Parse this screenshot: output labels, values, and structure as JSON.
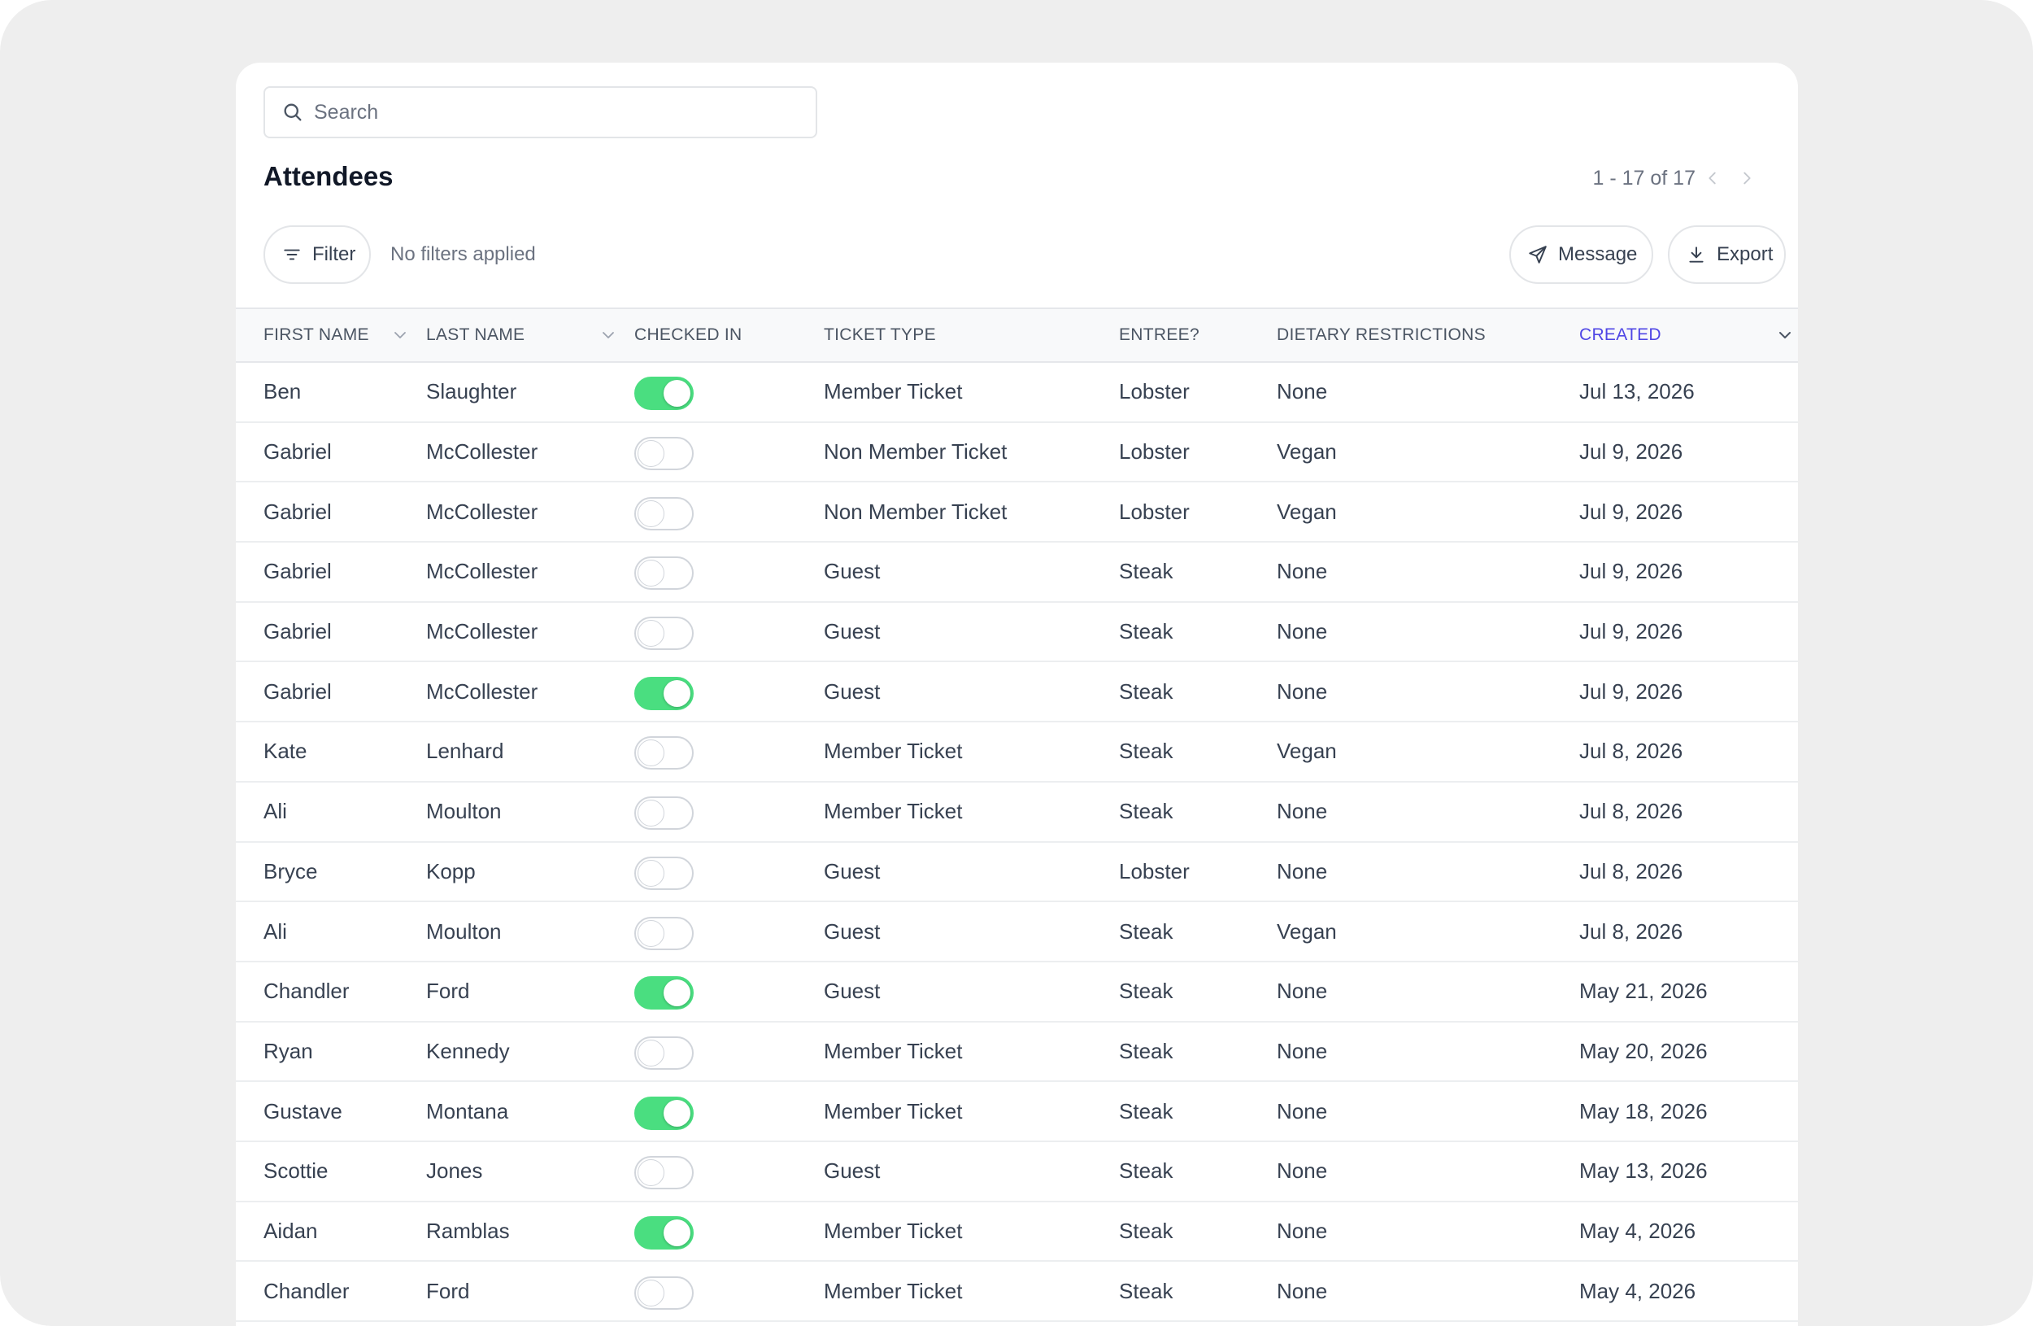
{
  "search": {
    "placeholder": "Search",
    "value": ""
  },
  "page_title": "Attendees",
  "pagination": {
    "range_text": "1 - 17 of 17"
  },
  "toolbar": {
    "filter_label": "Filter",
    "filter_status": "No filters applied",
    "message_label": "Message",
    "export_label": "Export"
  },
  "colors": {
    "toggle_on": "#4ade80",
    "active_sort_header": "#4f46e5"
  },
  "table": {
    "columns": [
      {
        "key": "first_name",
        "label": "FIRST NAME",
        "sortable": true,
        "active": false
      },
      {
        "key": "last_name",
        "label": "LAST NAME",
        "sortable": true,
        "active": false
      },
      {
        "key": "checked_in",
        "label": "CHECKED IN",
        "sortable": false,
        "active": false
      },
      {
        "key": "ticket_type",
        "label": "TICKET TYPE",
        "sortable": false,
        "active": false
      },
      {
        "key": "entree",
        "label": "ENTREE?",
        "sortable": false,
        "active": false
      },
      {
        "key": "dietary",
        "label": "DIETARY RESTRICTIONS",
        "sortable": false,
        "active": false
      },
      {
        "key": "created",
        "label": "CREATED",
        "sortable": true,
        "active": true
      }
    ],
    "rows": [
      {
        "first_name": "Ben",
        "last_name": "Slaughter",
        "checked_in": true,
        "ticket_type": "Member Ticket",
        "entree": "Lobster",
        "dietary": "None",
        "created": "Jul 13, 2026"
      },
      {
        "first_name": "Gabriel",
        "last_name": "McCollester",
        "checked_in": false,
        "ticket_type": "Non Member Ticket",
        "entree": "Lobster",
        "dietary": "Vegan",
        "created": "Jul 9, 2026"
      },
      {
        "first_name": "Gabriel",
        "last_name": "McCollester",
        "checked_in": false,
        "ticket_type": "Non Member Ticket",
        "entree": "Lobster",
        "dietary": "Vegan",
        "created": "Jul 9, 2026"
      },
      {
        "first_name": "Gabriel",
        "last_name": "McCollester",
        "checked_in": false,
        "ticket_type": "Guest",
        "entree": "Steak",
        "dietary": "None",
        "created": "Jul 9, 2026"
      },
      {
        "first_name": "Gabriel",
        "last_name": "McCollester",
        "checked_in": false,
        "ticket_type": "Guest",
        "entree": "Steak",
        "dietary": "None",
        "created": "Jul 9, 2026"
      },
      {
        "first_name": "Gabriel",
        "last_name": "McCollester",
        "checked_in": true,
        "ticket_type": "Guest",
        "entree": "Steak",
        "dietary": "None",
        "created": "Jul 9, 2026"
      },
      {
        "first_name": "Kate",
        "last_name": "Lenhard",
        "checked_in": false,
        "ticket_type": "Member Ticket",
        "entree": "Steak",
        "dietary": "Vegan",
        "created": "Jul 8, 2026"
      },
      {
        "first_name": "Ali",
        "last_name": "Moulton",
        "checked_in": false,
        "ticket_type": "Member Ticket",
        "entree": "Steak",
        "dietary": "None",
        "created": "Jul 8, 2026"
      },
      {
        "first_name": "Bryce",
        "last_name": "Kopp",
        "checked_in": false,
        "ticket_type": "Guest",
        "entree": "Lobster",
        "dietary": "None",
        "created": "Jul 8, 2026"
      },
      {
        "first_name": "Ali",
        "last_name": "Moulton",
        "checked_in": false,
        "ticket_type": "Guest",
        "entree": "Steak",
        "dietary": "Vegan",
        "created": "Jul 8, 2026"
      },
      {
        "first_name": "Chandler",
        "last_name": "Ford",
        "checked_in": true,
        "ticket_type": "Guest",
        "entree": "Steak",
        "dietary": "None",
        "created": "May 21, 2026"
      },
      {
        "first_name": "Ryan",
        "last_name": "Kennedy",
        "checked_in": false,
        "ticket_type": "Member Ticket",
        "entree": "Steak",
        "dietary": "None",
        "created": "May 20, 2026"
      },
      {
        "first_name": "Gustave",
        "last_name": "Montana",
        "checked_in": true,
        "ticket_type": "Member Ticket",
        "entree": "Steak",
        "dietary": "None",
        "created": "May 18, 2026"
      },
      {
        "first_name": "Scottie",
        "last_name": "Jones",
        "checked_in": false,
        "ticket_type": "Guest",
        "entree": "Steak",
        "dietary": "None",
        "created": "May 13, 2026"
      },
      {
        "first_name": "Aidan",
        "last_name": "Ramblas",
        "checked_in": true,
        "ticket_type": "Member Ticket",
        "entree": "Steak",
        "dietary": "None",
        "created": "May 4, 2026"
      },
      {
        "first_name": "Chandler",
        "last_name": "Ford",
        "checked_in": false,
        "ticket_type": "Member Ticket",
        "entree": "Steak",
        "dietary": "None",
        "created": "May 4, 2026"
      }
    ]
  }
}
